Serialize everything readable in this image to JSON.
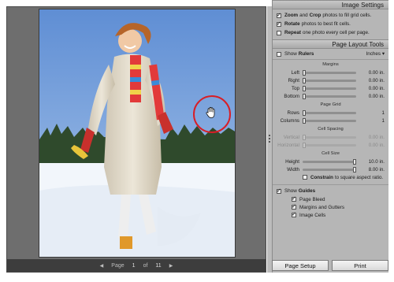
{
  "image_settings": {
    "title": "Image Settings",
    "options": [
      {
        "bold": "Zoom",
        "mid": "and",
        "bold2": "Crop",
        "rest": "photos to fill grid cells.",
        "checked": true
      },
      {
        "bold": "Rotate",
        "rest": "photos to best fit cells.",
        "checked": true
      },
      {
        "bold": "Repeat",
        "rest": "one photo every cell per page.",
        "checked": false
      }
    ]
  },
  "layout_tools": {
    "title": "Page Layout Tools",
    "rulers": {
      "label": "Show",
      "bold": "Rulers",
      "checked": false,
      "units": "Inches ▾"
    },
    "margins": {
      "title": "Margins",
      "rows": [
        {
          "label": "Left",
          "value": "0.00 in."
        },
        {
          "label": "Right",
          "value": "0.00 in."
        },
        {
          "label": "Top",
          "value": "0.00 in."
        },
        {
          "label": "Bottom",
          "value": "0.00 in."
        }
      ]
    },
    "page_grid": {
      "title": "Page Grid",
      "rows": [
        {
          "label": "Rows",
          "value": "1"
        },
        {
          "label": "Columns",
          "value": "1"
        }
      ]
    },
    "cell_spacing": {
      "title": "Cell Spacing",
      "rows": [
        {
          "label": "Vertical",
          "value": "0.00 in."
        },
        {
          "label": "Horizontal",
          "value": "0.00 in."
        }
      ]
    },
    "cell_size": {
      "title": "Cell Size",
      "rows": [
        {
          "label": "Height",
          "value": "10.0 in."
        },
        {
          "label": "Width",
          "value": "8.00 in."
        }
      ],
      "constrain_bold": "Constrain",
      "constrain_rest": "to square aspect ratio."
    }
  },
  "guides": {
    "label": "Show",
    "bold": "Guides",
    "checked": true,
    "items": [
      {
        "label": "Page Bleed",
        "checked": true
      },
      {
        "label": "Margins and Gutters",
        "checked": true
      },
      {
        "label": "Image Cells",
        "checked": true
      }
    ]
  },
  "pager": {
    "prefix": "Page",
    "current": "1",
    "of": "of",
    "total": "11"
  },
  "buttons": {
    "page_setup": "Page Setup",
    "print": "Print"
  },
  "colors": {
    "accent_circle": "#d81e26",
    "panel": "#b6b6b6",
    "workspace": "#6e6e6e"
  },
  "icons": {
    "hand": "hand-pan-icon",
    "prev": "triangle-left-icon",
    "next": "triangle-right-icon"
  }
}
